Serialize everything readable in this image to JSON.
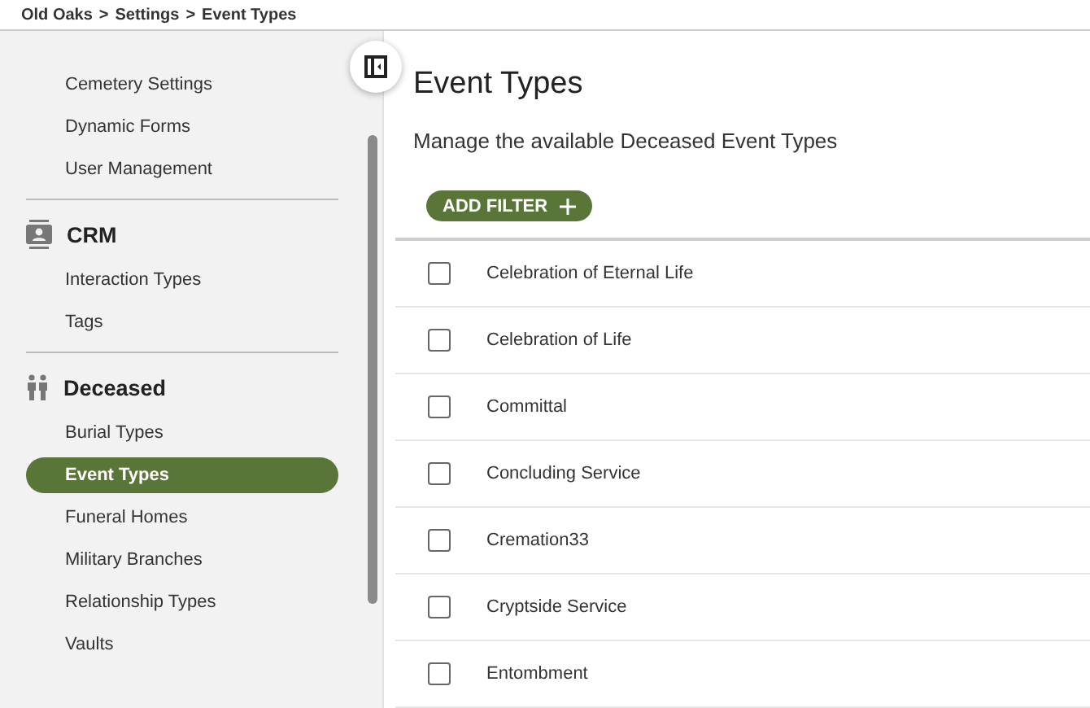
{
  "breadcrumb": [
    {
      "label": "Old Oaks"
    },
    {
      "label": ">"
    },
    {
      "label": "Settings"
    },
    {
      "label": ">"
    },
    {
      "label": "Event Types"
    }
  ],
  "sidebar": {
    "sections": [
      {
        "items": [
          {
            "label": "Cemetery Settings",
            "selected": false
          },
          {
            "label": "Dynamic Forms",
            "selected": false
          },
          {
            "label": "User Management",
            "selected": false
          }
        ]
      },
      {
        "title": "CRM",
        "kind": "contact",
        "items": [
          {
            "label": "Interaction Types",
            "selected": false
          },
          {
            "label": "Tags",
            "selected": false
          }
        ]
      },
      {
        "title": "Deceased",
        "kind": "people",
        "items": [
          {
            "label": "Burial Types",
            "selected": false
          },
          {
            "label": "Event Types",
            "selected": true
          },
          {
            "label": "Funeral Homes",
            "selected": false
          },
          {
            "label": "Military Branches",
            "selected": false
          },
          {
            "label": "Relationship Types",
            "selected": false
          },
          {
            "label": "Vaults",
            "selected": false
          }
        ]
      }
    ]
  },
  "page": {
    "title": "Event Types",
    "subtitle": "Manage the available Deceased Event Types",
    "add_filter": "ADD FILTER"
  },
  "table": {
    "rows": [
      {
        "name": "Celebration of Eternal Life",
        "checked": false
      },
      {
        "name": "Celebration of Life",
        "checked": false
      },
      {
        "name": "Committal",
        "checked": false
      },
      {
        "name": "Concluding Service",
        "checked": false
      },
      {
        "name": "Cremation33",
        "checked": false
      },
      {
        "name": "Cryptside Service",
        "checked": false
      },
      {
        "name": "Entombment",
        "checked": false
      }
    ]
  }
}
